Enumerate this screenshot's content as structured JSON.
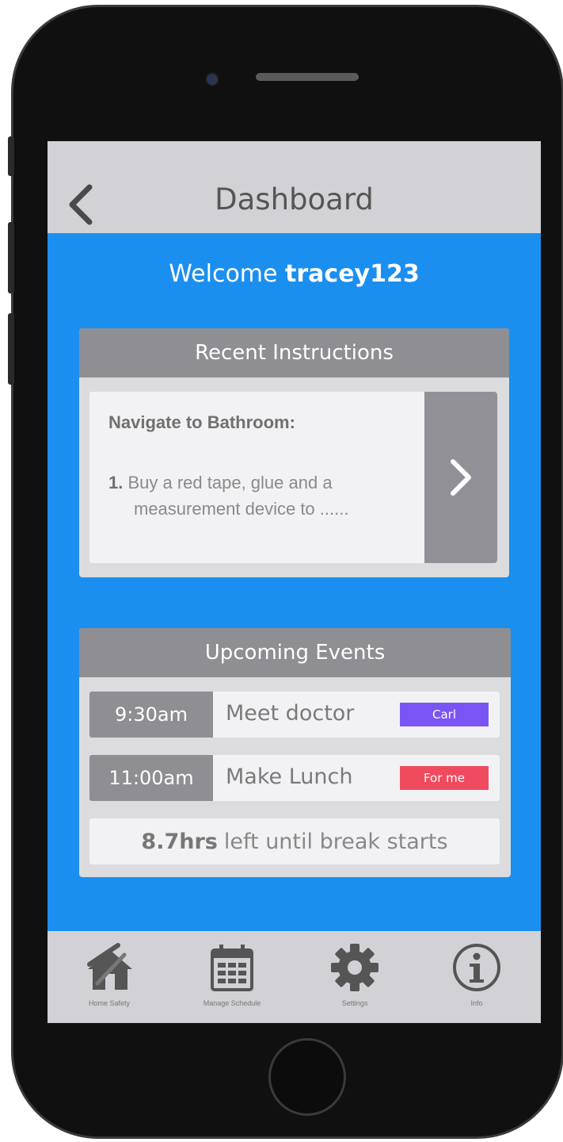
{
  "header": {
    "title": "Dashboard",
    "back_icon": "chevron-left-icon"
  },
  "welcome": {
    "prefix": "Welcome",
    "username": "tracey123"
  },
  "recent_instructions": {
    "heading": "Recent Instructions",
    "title": "Navigate to Bathroom:",
    "step_number": "1.",
    "step_line1": "Buy a red tape, glue and a",
    "step_line2": "measurement device to ......",
    "open_icon": "chevron-right-icon"
  },
  "upcoming_events": {
    "heading": "Upcoming Events",
    "events": [
      {
        "time": "9:30am",
        "name": "Meet doctor",
        "tag": "Carl",
        "tag_color": "#7a55f5"
      },
      {
        "time": "11:00am",
        "name": "Make Lunch",
        "tag": "For me",
        "tag_color": "#f04a5e"
      }
    ],
    "break_value": "8.7hrs",
    "break_text": "left until break starts"
  },
  "tabs": [
    {
      "label": "Home Safety",
      "icon": "home-safety-icon"
    },
    {
      "label": "Manage Schedule",
      "icon": "calendar-icon"
    },
    {
      "label": "Settings",
      "icon": "gear-icon"
    },
    {
      "label": "Info",
      "icon": "info-icon"
    }
  ],
  "colors": {
    "screen_bg": "#1b8ff0",
    "bar_bg": "#d2d2d6",
    "card_header": "#8e8e93"
  }
}
